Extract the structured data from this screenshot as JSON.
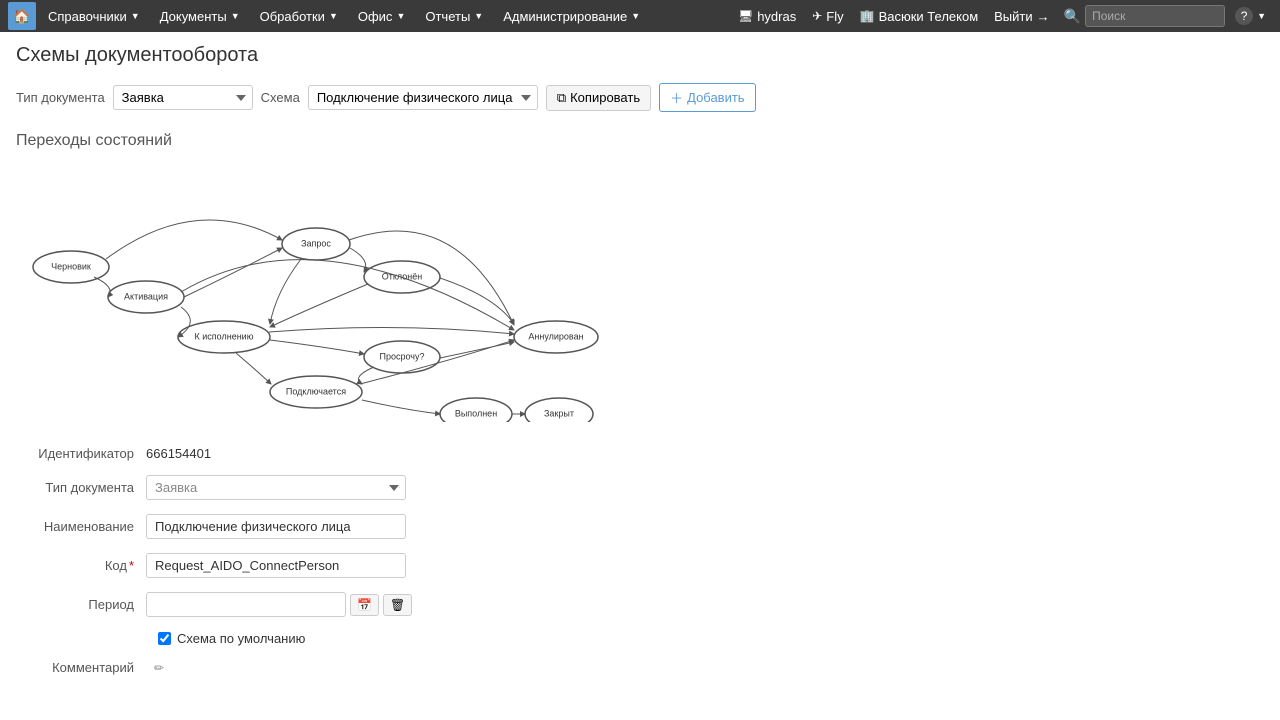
{
  "topnav": {
    "home_icon": "🏠",
    "menu_items": [
      {
        "label": "Справочники",
        "has_arrow": true
      },
      {
        "label": "Документы",
        "has_arrow": true
      },
      {
        "label": "Обработки",
        "has_arrow": true
      },
      {
        "label": "Офис",
        "has_arrow": true
      },
      {
        "label": "Отчеты",
        "has_arrow": true
      },
      {
        "label": "Администрирование",
        "has_arrow": true
      }
    ],
    "hydras_icon": "🖥",
    "hydras_label": "hydras",
    "fly_icon": "✈",
    "fly_label": "Fly",
    "company_icon": "🏢",
    "company_label": "Васюки Телеком",
    "logout_label": "Выйти",
    "logout_icon": "→",
    "search_placeholder": "Поиск",
    "help_label": "?"
  },
  "page": {
    "title": "Схемы документооборота",
    "doc_type_label": "Тип документа",
    "schema_label": "Схема",
    "doc_type_value": "Заявка",
    "schema_value": "Подключение физического лица",
    "copy_btn": "Копировать",
    "add_btn": "Добавить",
    "transitions_title": "Переходы состояний",
    "id_label": "Идентификатор",
    "id_value": "666154401",
    "form_doc_type_label": "Тип документа",
    "form_doc_type_value": "Заявка",
    "name_label": "Наименование",
    "name_value": "Подключение физического лица",
    "code_label": "Код",
    "code_value": "Request_AIDO_ConnectPerson",
    "period_label": "Период",
    "period_value": "",
    "default_schema_label": "Схема по умолчанию",
    "default_schema_checked": true,
    "comment_label": "Комментарий",
    "calendar_icon": "📅",
    "clear_icon": "🗑",
    "edit_icon": "✏"
  }
}
